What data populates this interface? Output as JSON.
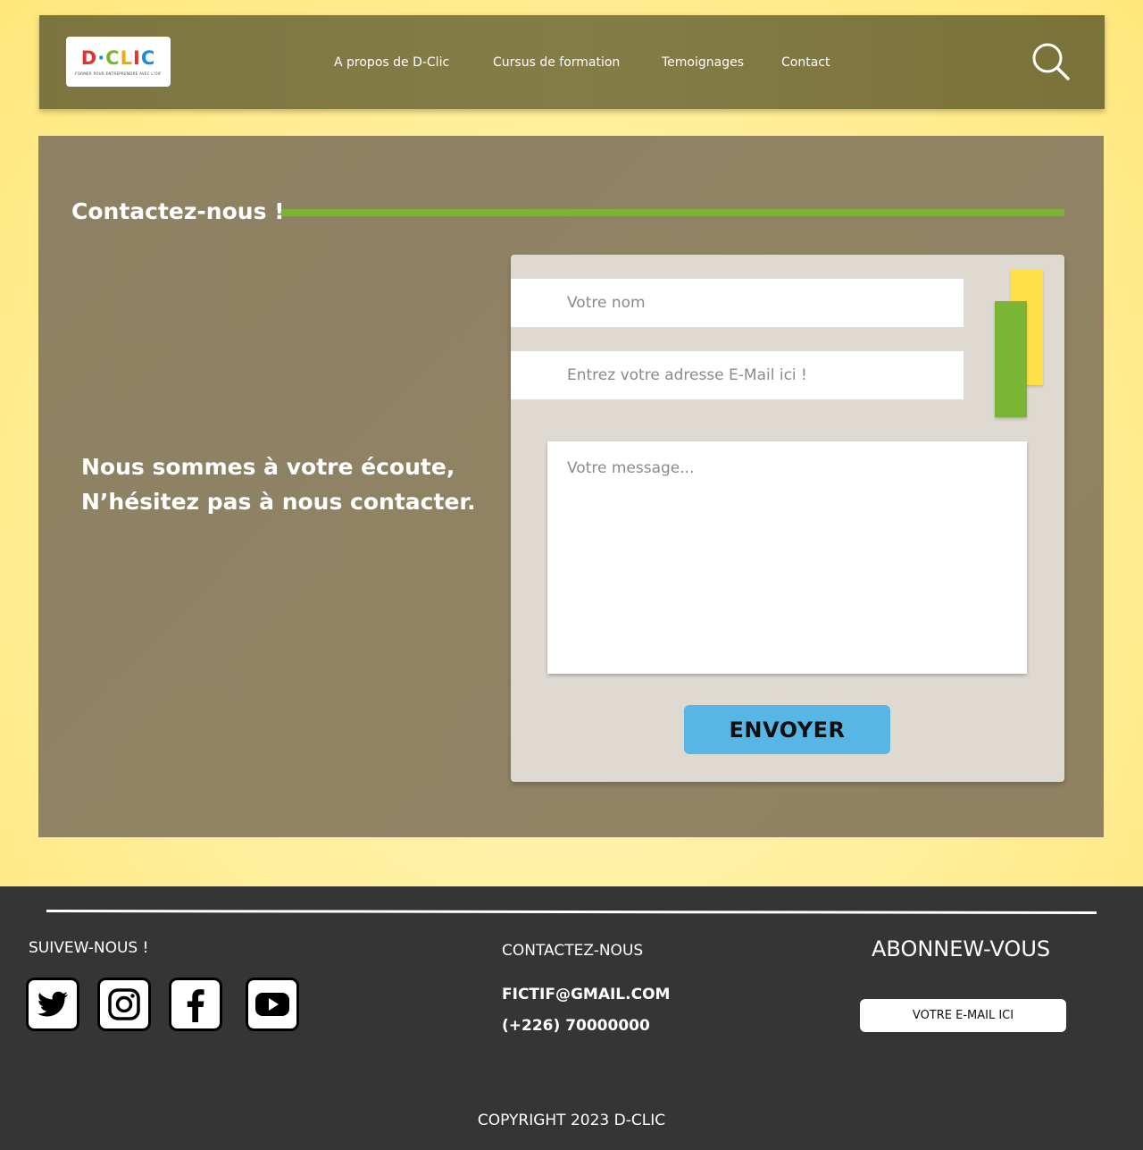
{
  "nav": {
    "logo": {
      "letters": [
        {
          "ch": "D",
          "color": "#e6332a"
        },
        {
          "ch": "·",
          "color": "#1a8fd6"
        },
        {
          "ch": "C",
          "color": "#7ab530"
        },
        {
          "ch": "L",
          "color": "#f2a900"
        },
        {
          "ch": "I",
          "color": "#e6332a"
        },
        {
          "ch": "C",
          "color": "#1a8fd6"
        }
      ],
      "subtitle": "FORMER POUR ENTREPRENDRE AVEC L'OIF"
    },
    "links": [
      {
        "label": "A propos de D-Clic"
      },
      {
        "label": "Cursus de formation"
      },
      {
        "label": "Temoignages"
      },
      {
        "label": "Contact"
      }
    ],
    "search_icon": "search-icon"
  },
  "contact": {
    "title": "Contactez-nous !",
    "tagline_line1": "Nous sommes à  votre écoute,",
    "tagline_line2": "N’hésitez pas à nous contacter.",
    "form": {
      "name_placeholder": "Votre nom",
      "email_placeholder": "Entrez votre adresse E-Mail ici !",
      "message_placeholder": "Votre message...",
      "submit_label": "ENVOYER"
    }
  },
  "footer": {
    "follow_heading": "SUIVEW-NOUS !",
    "social": [
      "twitter-icon",
      "instagram-icon",
      "facebook-icon",
      "youtube-icon"
    ],
    "contact_heading": "CONTACTEZ-NOUS",
    "email": "FICTIF@GMAIL.COM",
    "phone": "(+226) 70000000",
    "subscribe_heading": "ABONNEW-VOUS",
    "newsletter_placeholder": "VOTRE E-MAIL ICI",
    "copyright": "COPYRIGHT 2023 D-CLIC"
  },
  "colors": {
    "navbar": "#7d7540",
    "panel": "#8e8163",
    "accent_green": "#7ab530",
    "accent_yellow": "#ffe04a",
    "button_blue": "#58b6e6",
    "footer": "#353535"
  }
}
